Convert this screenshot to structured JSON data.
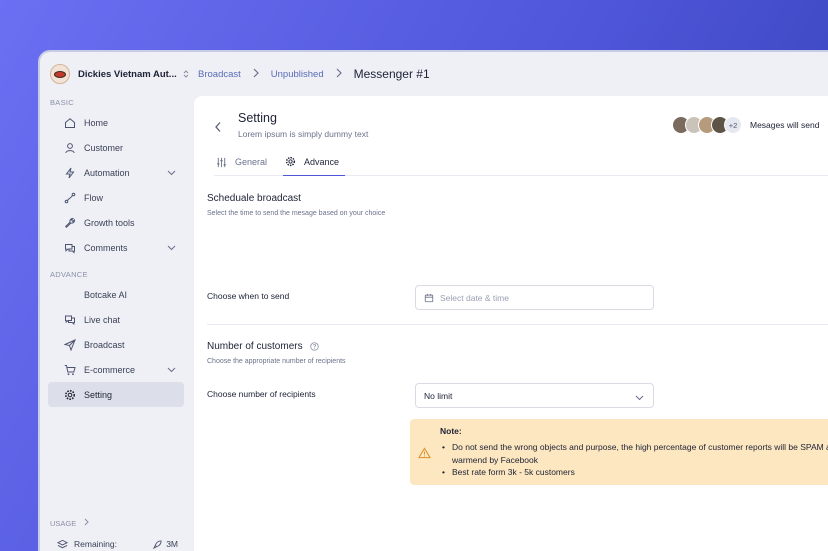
{
  "workspace": {
    "name": "Dickies Vietnam Aut..."
  },
  "breadcrumbs": {
    "items": [
      "Broadcast",
      "Unpublished"
    ],
    "current": "Messenger #1"
  },
  "sidebar": {
    "basic_label": "BASIC",
    "basic_items": [
      {
        "label": "Home",
        "icon": "home-icon"
      },
      {
        "label": "Customer",
        "icon": "user-icon"
      },
      {
        "label": "Automation",
        "icon": "lightning-icon"
      },
      {
        "label": "Flow",
        "icon": "flow-icon"
      },
      {
        "label": "Growth tools",
        "icon": "wrench-icon"
      },
      {
        "label": "Comments",
        "icon": "comment-icon"
      }
    ],
    "advance_label": "ADVANCE",
    "advance_items": [
      {
        "label": "Botcake AI",
        "icon": ""
      },
      {
        "label": "Live chat",
        "icon": "chat-icon"
      },
      {
        "label": "Broadcast",
        "icon": "send-icon"
      },
      {
        "label": "E-commerce",
        "icon": "cart-icon"
      },
      {
        "label": "Setting",
        "icon": "gear-icon"
      }
    ],
    "usage_label": "USAGE",
    "remaining_label": "Remaining:",
    "remaining_value": "3M"
  },
  "header": {
    "title": "Setting",
    "subtitle": "Lorem ipsum is simply dummy text",
    "avatars_more": "+2",
    "send_text": "Mesages will send"
  },
  "tabs": {
    "general": "General",
    "advance": "Advance"
  },
  "schedule": {
    "title": "Scheduale broadcast",
    "desc": "Select the time to send the mesage based on your choice",
    "field_label": "Choose when to send",
    "placeholder": "Select date & time"
  },
  "customers": {
    "title": "Number of customers",
    "desc": "Choose the appropriate number of recipients",
    "field_label": "Choose number of recipients",
    "selected": "No limit"
  },
  "note": {
    "title": "Note:",
    "items": [
      "Do not send the wrong objects and purpose, the high percentage of customer reports will be SPAM and be warmend by Facebook",
      "Best rate form 3k  - 5k customers"
    ]
  },
  "colors": {
    "accent": "#4e55d8",
    "note_bg": "#fde7c0",
    "active_nav_bg": "#dcdfe9"
  }
}
